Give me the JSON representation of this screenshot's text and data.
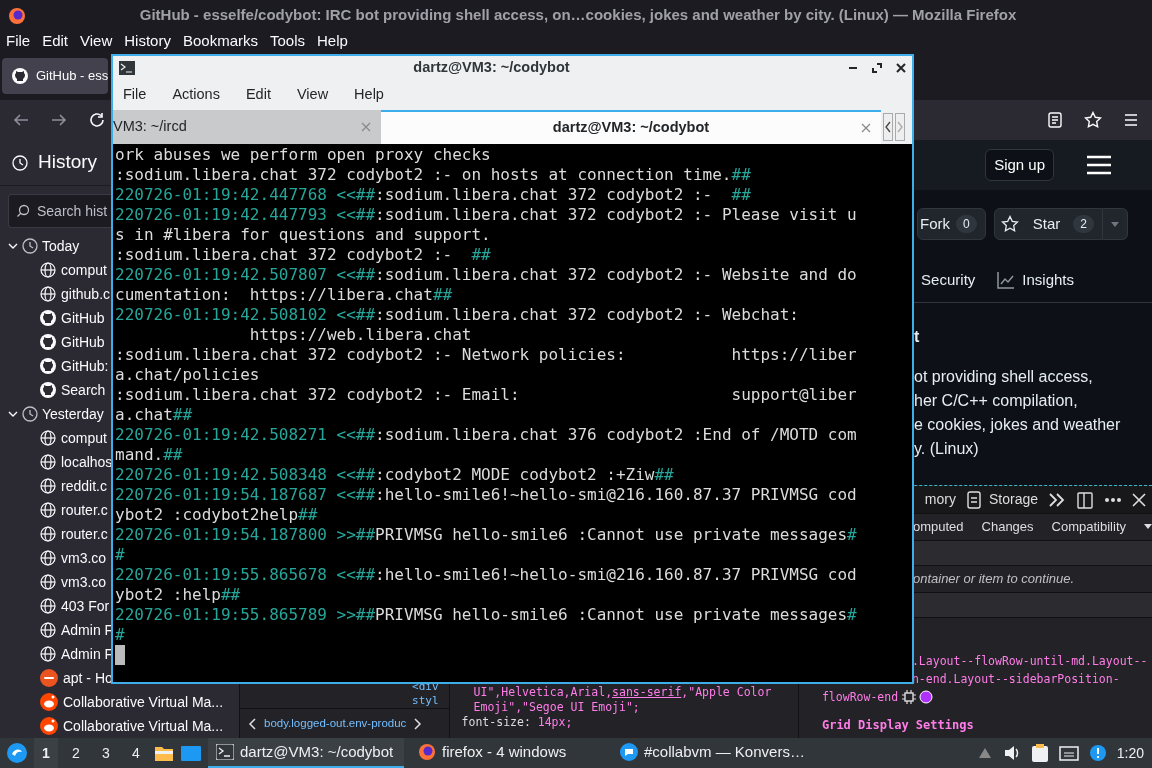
{
  "firefox": {
    "title": "GitHub - esselfe/codybot: IRC bot providing shell access, on…cookies, jokes and weather by city. (Linux) — Mozilla Firefox",
    "menu": [
      "File",
      "Edit",
      "View",
      "History",
      "Bookmarks",
      "Tools",
      "Help"
    ],
    "tabs": [
      {
        "label": "GitHub - ess",
        "selected": true
      }
    ],
    "sidebar": {
      "title": "History",
      "search": {
        "placeholder": "Search hist"
      },
      "groups": [
        {
          "label": "Today",
          "expanded": true,
          "children": [
            {
              "label": "comput",
              "kind": "globe"
            },
            {
              "label": "github.c",
              "kind": "globe"
            },
            {
              "label": "GitHub",
              "kind": "github"
            },
            {
              "label": "GitHub",
              "kind": "github"
            },
            {
              "label": "GitHub:",
              "kind": "github"
            },
            {
              "label": "Search",
              "kind": "github"
            }
          ]
        },
        {
          "label": "Yesterday",
          "expanded": true,
          "children": [
            {
              "label": "comput",
              "kind": "globe"
            },
            {
              "label": "localhos",
              "kind": "globe"
            },
            {
              "label": "reddit.c",
              "kind": "globe"
            },
            {
              "label": "router.c",
              "kind": "globe"
            },
            {
              "label": "router.c",
              "kind": "globe"
            },
            {
              "label": "vm3.co",
              "kind": "globe"
            },
            {
              "label": "vm3.co",
              "kind": "globe"
            },
            {
              "label": "403 For",
              "kind": "globe"
            },
            {
              "label": "Admin F",
              "kind": "globe"
            },
            {
              "label": "Admin F",
              "kind": "globe"
            },
            {
              "label": "apt - Ho",
              "kind": "ask"
            },
            {
              "label": "Collaborative Virtual Ma...",
              "kind": "reddit"
            },
            {
              "label": "Collaborative Virtual Ma...",
              "kind": "reddit"
            }
          ]
        }
      ]
    },
    "page": {
      "signup": "Sign up",
      "fork": {
        "label": "Fork",
        "count": "0"
      },
      "star": {
        "label": "Star",
        "count": "2"
      },
      "nav": [
        {
          "label": "Security",
          "kind": "text"
        },
        {
          "label": "Insights",
          "kind": "graph"
        }
      ],
      "about_heading": "t",
      "about_lines": [
        "ot providing shell access,",
        "her C/C++ compilation,",
        "e cookies, jokes and weather",
        "y. (Linux)"
      ]
    },
    "devtools": {
      "tabs": [
        {
          "label": "mory",
          "kind": "text"
        },
        {
          "label": "Storage",
          "kind": "storage"
        }
      ],
      "side_tabs": [
        "omputed",
        "Changes",
        "Compatibility"
      ],
      "message": "ontainer or item to continue.",
      "code_lines": [
        ".Layout--flowRow-until-md.Layout--",
        "n-end.Layout--sidebarPosition-",
        "flowRow-end"
      ],
      "grid_heading": "Grid Display Settings",
      "markup_lines": [
        "<div",
        "styl"
      ],
      "breadcrumb": "body.logged-out.env-produc",
      "rule_lines": [
        "UI\",Helvetica,Arial,**sans-serif**,\"Apple Color",
        "Emoji\",\"Segoe UI Emoji\";"
      ],
      "rule_decl": {
        "property": "font-size:",
        "value": "14px;"
      }
    }
  },
  "terminal": {
    "title": "dartz@VM3: ~/codybot",
    "menu": [
      "File",
      "Actions",
      "Edit",
      "View",
      "Help"
    ],
    "tabs": [
      {
        "label": "VM3: ~/ircd",
        "selected": false
      },
      {
        "label": "dartz@VM3: ~/codybot",
        "selected": true
      }
    ],
    "lines": [
      [
        {
          "text": "ork abuses we perform open proxy checks",
          "kind": "plain"
        }
      ],
      [
        {
          "text": ":sodium.libera.chat 372 codybot2 :- on hosts at connection time.",
          "kind": "plain"
        },
        {
          "text": "##",
          "kind": "accent"
        }
      ],
      [
        {
          "text": "220726-01:19:42.447768 <<##",
          "kind": "accent"
        },
        {
          "text": ":sodium.libera.chat 372 codybot2 :-  ",
          "kind": "plain"
        },
        {
          "text": "##",
          "kind": "accent"
        }
      ],
      [
        {
          "text": "220726-01:19:42.447793 <<##",
          "kind": "accent"
        },
        {
          "text": ":sodium.libera.chat 372 codybot2 :- Please visit u",
          "kind": "plain"
        }
      ],
      [
        {
          "text": "s in #libera for questions and support.",
          "kind": "plain"
        }
      ],
      [
        {
          "text": ":sodium.libera.chat 372 codybot2 :-  ",
          "kind": "plain"
        },
        {
          "text": "##",
          "kind": "accent"
        }
      ],
      [
        {
          "text": "220726-01:19:42.507807 <<##",
          "kind": "accent"
        },
        {
          "text": ":sodium.libera.chat 372 codybot2 :- Website and do",
          "kind": "plain"
        }
      ],
      [
        {
          "text": "cumentation:  https://libera.chat",
          "kind": "plain"
        },
        {
          "text": "##",
          "kind": "accent"
        }
      ],
      [
        {
          "text": "220726-01:19:42.508102 <<##",
          "kind": "accent"
        },
        {
          "text": ":sodium.libera.chat 372 codybot2 :- Webchat:",
          "kind": "plain"
        }
      ],
      [
        {
          "text": "              https://web.libera.chat",
          "kind": "plain"
        }
      ],
      [
        {
          "text": ":sodium.libera.chat 372 codybot2 :- Network policies:           https://liber",
          "kind": "plain"
        }
      ],
      [
        {
          "text": "a.chat/policies",
          "kind": "plain"
        }
      ],
      [
        {
          "text": ":sodium.libera.chat 372 codybot2 :- Email:                      support@liber",
          "kind": "plain"
        }
      ],
      [
        {
          "text": "a.chat",
          "kind": "plain"
        },
        {
          "text": "##",
          "kind": "accent"
        }
      ],
      [
        {
          "text": "220726-01:19:42.508271 <<##",
          "kind": "accent"
        },
        {
          "text": ":sodium.libera.chat 376 codybot2 :End of /MOTD com",
          "kind": "plain"
        }
      ],
      [
        {
          "text": "mand.",
          "kind": "plain"
        },
        {
          "text": "##",
          "kind": "accent"
        }
      ],
      [
        {
          "text": "220726-01:19:42.508348 <<##",
          "kind": "accent"
        },
        {
          "text": ":codybot2 MODE codybot2 :+Ziw",
          "kind": "plain"
        },
        {
          "text": "##",
          "kind": "accent"
        }
      ],
      [
        {
          "text": "220726-01:19:54.187687 <<##",
          "kind": "accent"
        },
        {
          "text": ":hello-smile6!~hello-smi@216.160.87.37 PRIVMSG cod",
          "kind": "plain"
        }
      ],
      [
        {
          "text": "ybot2 :codybot2help",
          "kind": "plain"
        },
        {
          "text": "##",
          "kind": "accent"
        }
      ],
      [
        {
          "text": "220726-01:19:54.187800 >>##",
          "kind": "accent"
        },
        {
          "text": "PRIVMSG hello-smile6 :Cannot use private messages",
          "kind": "plain"
        },
        {
          "text": "#",
          "kind": "accent"
        }
      ],
      [
        {
          "text": "#",
          "kind": "accent"
        }
      ],
      [
        {
          "text": "220726-01:19:55.865678 <<##",
          "kind": "accent"
        },
        {
          "text": ":hello-smile6!~hello-smi@216.160.87.37 PRIVMSG cod",
          "kind": "plain"
        }
      ],
      [
        {
          "text": "ybot2 :help",
          "kind": "plain"
        },
        {
          "text": "##",
          "kind": "accent"
        }
      ],
      [
        {
          "text": "220726-01:19:55.865789 >>##",
          "kind": "accent"
        },
        {
          "text": "PRIVMSG hello-smile6 :Cannot use private messages",
          "kind": "plain"
        },
        {
          "text": "#",
          "kind": "accent"
        }
      ],
      [
        {
          "text": "#",
          "kind": "accent"
        }
      ]
    ]
  },
  "taskbar": {
    "desktops": [
      {
        "label": "1",
        "selected": true
      },
      {
        "label": "2",
        "selected": false
      },
      {
        "label": "3",
        "selected": false
      },
      {
        "label": "4",
        "selected": false
      }
    ],
    "tasks": [
      {
        "label": "dartz@VM3: ~/codybot",
        "kind": "terminal",
        "selected": true
      },
      {
        "label": "firefox - 4 windows",
        "kind": "firefox",
        "selected": false
      },
      {
        "label": "#collabvm — Konvers…",
        "kind": "chat",
        "selected": false
      }
    ],
    "clock": "1:20"
  }
}
